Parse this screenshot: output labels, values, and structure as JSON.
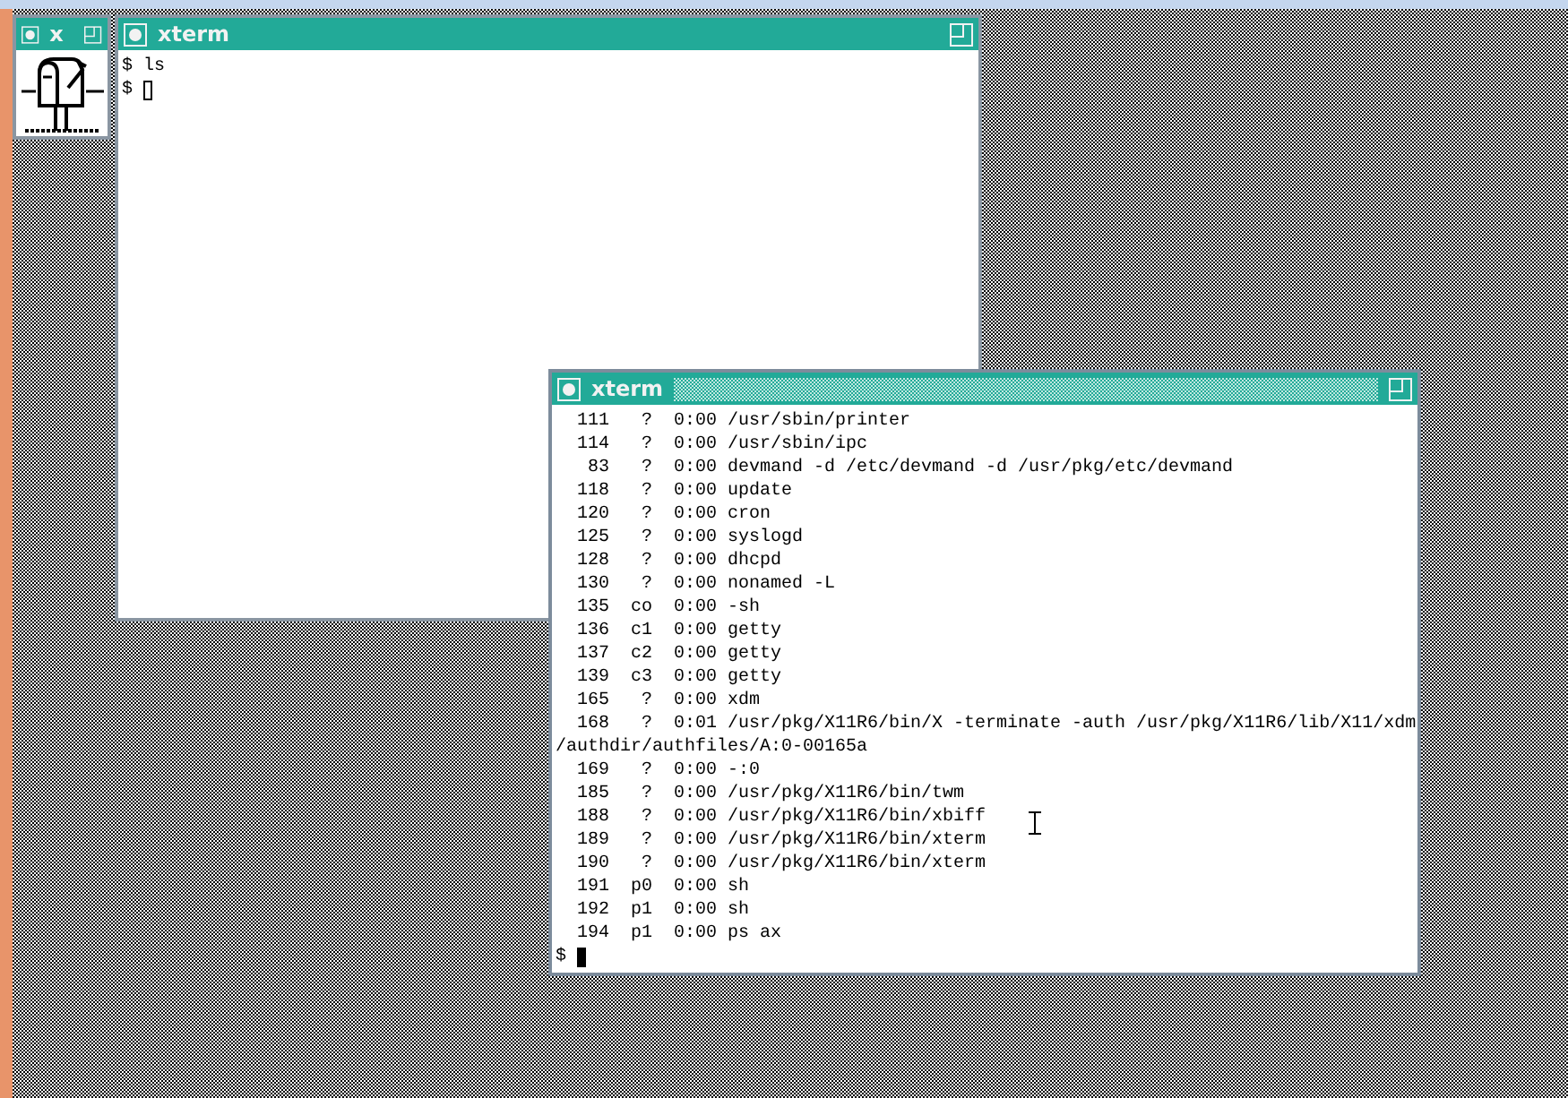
{
  "windows": [
    {
      "kind": "xbiff",
      "title": "x",
      "focused": false
    },
    {
      "kind": "xterm",
      "title": "xterm",
      "focused": false,
      "lines": [
        "$ ls"
      ],
      "prompt": "$"
    },
    {
      "kind": "xterm",
      "title": "xterm",
      "focused": true,
      "lines": [
        "  111   ?  0:00 /usr/sbin/printer",
        "  114   ?  0:00 /usr/sbin/ipc",
        "   83   ?  0:00 devmand -d /etc/devmand -d /usr/pkg/etc/devmand",
        "  118   ?  0:00 update",
        "  120   ?  0:00 cron",
        "  125   ?  0:00 syslogd",
        "  128   ?  0:00 dhcpd",
        "  130   ?  0:00 nonamed -L",
        "  135  co  0:00 -sh",
        "  136  c1  0:00 getty",
        "  137  c2  0:00 getty",
        "  139  c3  0:00 getty",
        "  165   ?  0:00 xdm",
        "  168   ?  0:01 /usr/pkg/X11R6/bin/X -terminate -auth /usr/pkg/X11R6/lib/X11/xdm",
        "/authdir/authfiles/A:0-00165a",
        "  169   ?  0:00 -:0",
        "  185   ?  0:00 /usr/pkg/X11R6/bin/twm",
        "  188   ?  0:00 /usr/pkg/X11R6/bin/xbiff",
        "  189   ?  0:00 /usr/pkg/X11R6/bin/xterm",
        "  190   ?  0:00 /usr/pkg/X11R6/bin/xterm",
        "  191  p0  0:00 sh",
        "  192  p1  0:00 sh",
        "  194  p1  0:00 ps ax"
      ],
      "prompt": "$"
    }
  ]
}
